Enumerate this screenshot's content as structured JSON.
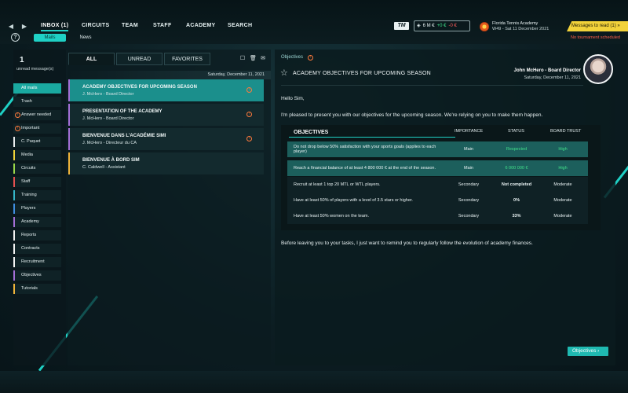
{
  "nav": {
    "tabs": [
      {
        "label": "INBOX (1)"
      },
      {
        "label": "CIRCUITS"
      },
      {
        "label": "TEAM"
      },
      {
        "label": "STAFF"
      },
      {
        "label": "ACADEMY"
      },
      {
        "label": "SEARCH"
      }
    ],
    "subtabs": [
      {
        "label": "Mails"
      },
      {
        "label": "News"
      }
    ]
  },
  "header": {
    "logo": "TM",
    "finance": {
      "balance": "6 M €",
      "gain": "+0 €",
      "loss": "-0 €"
    },
    "club": {
      "name": "Florida Tennis Academy",
      "date": "W49 - Sat 11 December 2021"
    },
    "messages_banner": "Messages to read (1)",
    "tournament_status": "No tournament scheduled"
  },
  "sidebar": {
    "unread_count": "1",
    "unread_label": "unread message(s)",
    "items": [
      {
        "label": "All mails",
        "color": ""
      },
      {
        "label": "Trash",
        "color": ""
      },
      {
        "label": "Answer needed",
        "color": ""
      },
      {
        "label": "Important",
        "color": ""
      },
      {
        "label": "C. Paquet",
        "color": "#e9edee"
      },
      {
        "label": "Media",
        "color": "#f0d33a"
      },
      {
        "label": "Circuits",
        "color": "#9ad74a"
      },
      {
        "label": "Staff",
        "color": "#e45050"
      },
      {
        "label": "Training",
        "color": "#35b6c9"
      },
      {
        "label": "Players",
        "color": "#3f8ee0"
      },
      {
        "label": "Academy",
        "color": "#a46fd6"
      },
      {
        "label": "Reports",
        "color": "#f2f2f2"
      },
      {
        "label": "Contracts",
        "color": "#f2f2f2"
      },
      {
        "label": "Recruitment",
        "color": "#f2f2f2"
      },
      {
        "label": "Objectives",
        "color": "#a46fd6"
      },
      {
        "label": "Tutorials",
        "color": "#f0b43a"
      }
    ]
  },
  "maillist": {
    "filters": [
      {
        "label": "ALL"
      },
      {
        "label": "UNREAD"
      },
      {
        "label": "FAVORITES"
      }
    ],
    "date": "Saturday, December 11, 2021",
    "mails": [
      {
        "subject": "ACADEMY OBJECTIVES FOR UPCOMING SEASON",
        "sender": "J. McHero - Board Director",
        "color": "#a46fd6"
      },
      {
        "subject": "PRESENTATION OF THE ACADEMY",
        "sender": "J. McHero - Board Director",
        "color": "#a46fd6"
      },
      {
        "subject": "BIENVENUE DANS L'ACADÉMIE SIMI",
        "sender": "J. McHero - Directeur du CA",
        "color": "#a46fd6"
      },
      {
        "subject": "BIENVENUE À BORD SIM",
        "sender": "C. Caldwell - Assistant",
        "color": "#f0b43a"
      }
    ]
  },
  "message": {
    "category": "Objectives",
    "title": "ACADEMY OBJECTIVES FOR UPCOMING SEASON",
    "from": "John McHero - Board Director",
    "date": "Saturday, December 11, 2021",
    "greeting": "Hello Sim,",
    "intro": "I'm pleased to present you with our objectives for the upcoming season. We're relying on you to make them happen.",
    "outro": "Before leaving you to your tasks, I just want to remind you to regularly follow the evolution of academy finances.",
    "objectives_button": "Objectives",
    "table": {
      "headers": {
        "objectives": "OBJECTIVES",
        "importance": "IMPORTANCE",
        "status": "STATUS",
        "trust": "BOARD TRUST"
      },
      "rows": [
        {
          "objective": "Do not drop below 50% satisfaction with your sports goals (applies to each player)",
          "importance": "Main",
          "status": "Respected",
          "trust": "High"
        },
        {
          "objective": "Reach a financial balance of at least 4 800 000 € at the end of the season.",
          "importance": "Main",
          "status": "6 000 000 €",
          "trust": "High"
        },
        {
          "objective": "Recruit at least 1 top 20 MTL or WTL players.",
          "importance": "Secondary",
          "status": "Not completed",
          "trust": "Moderate"
        },
        {
          "objective": "Have at least 50% of players with a level of 3.5 stars or higher.",
          "importance": "Secondary",
          "status": "0%",
          "trust": "Moderate"
        },
        {
          "objective": "Have at least 50% women on the team.",
          "importance": "Secondary",
          "status": "33%",
          "trust": "Moderate"
        }
      ]
    }
  }
}
